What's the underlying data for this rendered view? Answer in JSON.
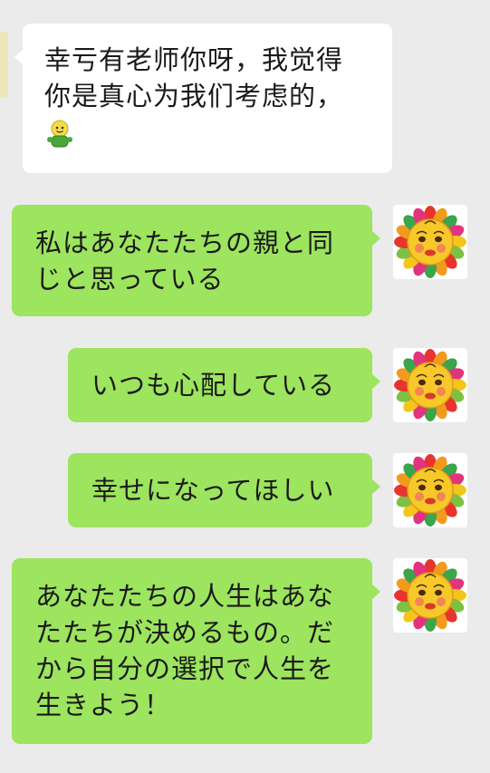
{
  "messages": [
    {
      "side": "left",
      "lines": [
        "幸亏有老师你呀，我觉得",
        "你是真心为我们考虑的，"
      ],
      "emoji": "smiley-person-emoji"
    },
    {
      "side": "right",
      "lines": [
        "私はあなたたちの親と同",
        "じと思っている"
      ]
    },
    {
      "side": "right",
      "lines": [
        "いつも心配している"
      ]
    },
    {
      "side": "right",
      "lines": [
        "幸せになってほしい"
      ]
    },
    {
      "side": "right",
      "lines": [
        "あなたたちの人生はあな",
        "たたちが決めるもの。だ",
        "から自分の選択で人生を",
        "生きよう！"
      ]
    }
  ],
  "avatar_icon": "sun-face-avatar-icon",
  "colors": {
    "background": "#ebebeb",
    "incoming_bubble": "#ffffff",
    "outgoing_bubble": "#9de45f",
    "text": "#1a1a1a"
  }
}
